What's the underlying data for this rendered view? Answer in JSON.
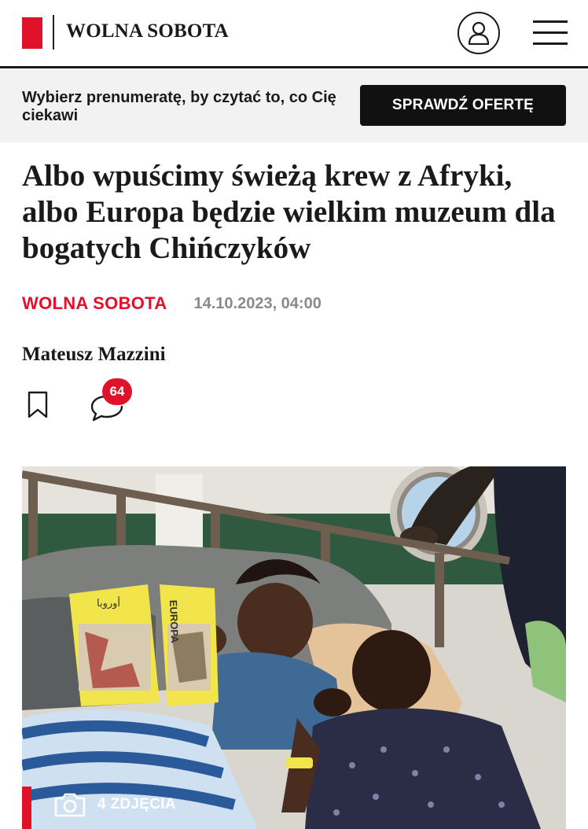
{
  "header": {
    "logo_text": "WOLNA SOBOTA",
    "brand_color": "#e0112b",
    "user_icon": "user-icon",
    "menu_icon": "hamburger-menu-icon"
  },
  "promo": {
    "text": "Wybierz prenumeratę, by czytać to, co Cię ciekawi",
    "button_label": "SPRAWDŹ OFERTĘ"
  },
  "article": {
    "headline": "Albo wpuścimy świeżą krew z Afryki, albo Europa będzie wielkim muzeum dla bogatych Chińczyków",
    "section": "WOLNA SOBOTA",
    "date": "14.10.2023, 04:00",
    "author": "Mateusz Mazzini",
    "comment_count": "64",
    "bookmark_icon": "bookmark-icon",
    "comment_icon": "comment-icon"
  },
  "photo": {
    "gallery_label": "4 ZDJĘCIA",
    "camera_icon": "camera-icon",
    "book_title": "EUROPA",
    "book_arabic": "أوروبا"
  }
}
